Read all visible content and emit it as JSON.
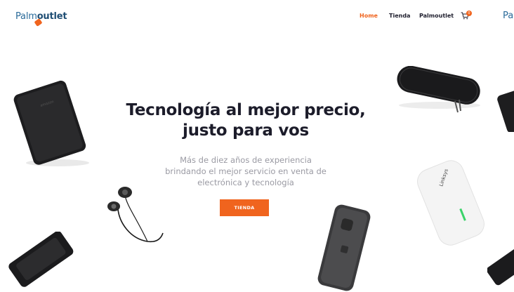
{
  "header": {
    "logo_part1": "Palm",
    "logo_part2": "outlet",
    "logo_partial_right": "Pa",
    "nav": [
      {
        "label": "Home",
        "active": true
      },
      {
        "label": "Tienda",
        "active": false
      },
      {
        "label": "Palmoutlet",
        "active": false
      }
    ],
    "cart_count": "0"
  },
  "hero": {
    "title_line1": "Tecnología al mejor precio,",
    "title_line2": "justo para vos",
    "subtitle_line1": "Más de diez años de experiencia",
    "subtitle_line2": "brindando el mejor servicio en venta de",
    "subtitle_line3": "electrónica y tecnología",
    "button_label": "TIENDA"
  },
  "products": {
    "kindle_brand": "amazon",
    "router_brand": "Linksys"
  },
  "colors": {
    "accent": "#f0641e",
    "brand_blue": "#1f4e74",
    "title": "#1c1c2a",
    "subtitle": "#9a9aa3"
  }
}
